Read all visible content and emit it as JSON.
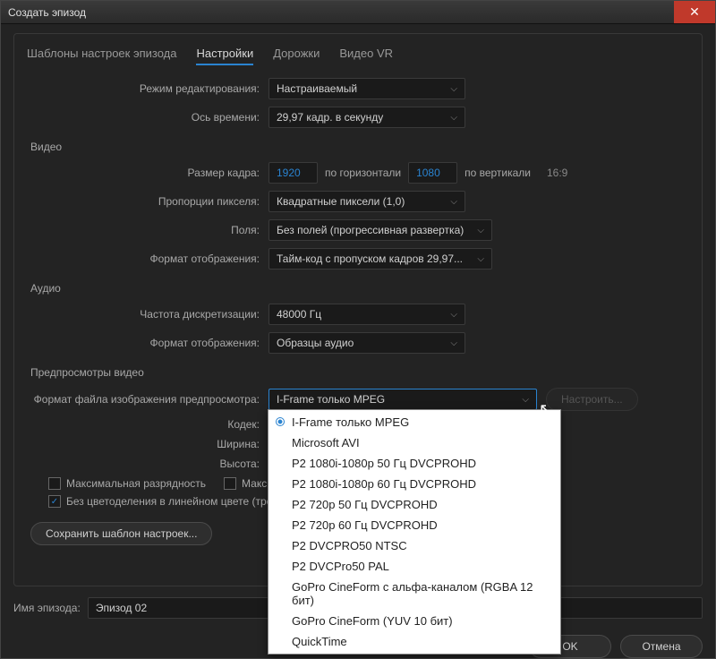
{
  "title": "Создать эпизод",
  "tabs": {
    "templates": "Шаблоны настроек эпизода",
    "settings": "Настройки",
    "tracks": "Дорожки",
    "vr": "Видео VR"
  },
  "labels": {
    "edit_mode": "Режим редактирования:",
    "timebase": "Ось времени:",
    "video": "Видео",
    "frame_size": "Размер кадра:",
    "horiz": "по горизонтали",
    "vert": "по вертикали",
    "aspect": "16:9",
    "pixel_aspect": "Пропорции пикселя:",
    "fields": "Поля:",
    "display_format_v": "Формат отображения:",
    "audio": "Аудио",
    "sample_rate": "Частота дискретизации:",
    "display_format_a": "Формат отображения:",
    "video_previews": "Предпросмотры видео",
    "preview_file_format": "Формат файла изображения предпросмотра:",
    "codec": "Кодек:",
    "width": "Ширина:",
    "height": "Высота:",
    "max_bit_depth": "Максимальная разрядность",
    "max_render_quality": "Максима",
    "linear_color": "Без цветоделения в линейном цвете (требу",
    "save_template": "Сохранить шаблон настроек...",
    "configure": "Настроить...",
    "episode_name": "Имя эпизода:",
    "ok": "OK",
    "cancel": "Отмена"
  },
  "values": {
    "edit_mode": "Настраиваемый",
    "timebase": "29,97  кадр. в секунду",
    "width": "1920",
    "height": "1080",
    "pixel_aspect": "Квадратные пиксели (1,0)",
    "fields": "Без полей (прогрессивная развертка)",
    "display_format_v": "Тайм-код с пропуском кадров 29,97...",
    "sample_rate": "48000 Гц",
    "display_format_a": "Образцы аудио",
    "preview_file_format": "I-Frame только MPEG",
    "episode_name": "Эпизод 02"
  },
  "dropdown": {
    "items": [
      "I-Frame только MPEG",
      "Microsoft AVI",
      "P2 1080i-1080p 50 Гц DVCPROHD",
      "P2 1080i-1080p 60 Гц DVCPROHD",
      "P2 720p 50 Гц DVCPROHD",
      "P2 720p 60 Гц DVCPROHD",
      "P2 DVCPRO50 NTSC",
      "P2 DVCPro50 PAL",
      "GoPro CineForm с альфа-каналом (RGBA 12 бит)",
      "GoPro CineForm (YUV 10 бит)",
      "QuickTime"
    ]
  }
}
